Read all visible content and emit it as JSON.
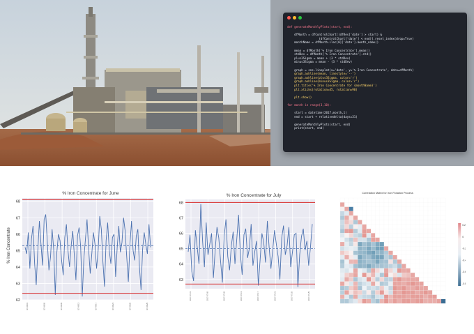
{
  "code": {
    "colors": {
      "bg": "#20232b",
      "keyword": "#ff7a90",
      "func": "#ffd66b",
      "string": "#8fe07a",
      "number": "#c98cff",
      "text": "#e2e6ee"
    },
    "dots": [
      "#ff5f57",
      "#febc2e",
      "#28c840"
    ],
    "lines": [
      "def generateMonthlyPlots(start, end):",
      "",
      "    dfMonth = dfControlChart[(dfRes['date'] > start) &",
      "                  (dfControlChart['date'] < end)].reset_index(drop=True)",
      "    monthName = dfMonth.iloc[0]['date'].month_name()",
      "",
      "    mean = dfMonth['% Iron Concentrate'].mean()",
      "    stdDev = dfMonth['% Iron Concentrate'].std()",
      "    plus3Sigma = mean + (3 * stdDev)",
      "    minus3Sigma = mean - (3 * stdDev)",
      "",
      "    graph = sns.lineplot(x='date', y='% Iron Concentrate', data=dfMonth)",
      "    graph.axhline(mean, linestyle='--')",
      "    graph.axhline(plus3Sigma, color='r')",
      "    graph.axhline(minus3Sigma, color='r')",
      "    plt.title('% Iron Concentrate for {monthName}')",
      "    plt.xticks(rotation=45, rotation=90)",
      "",
      "    plt.show()",
      "",
      "for month in range(3,10):",
      "",
      "    start = datetime(2017,month,1)",
      "    end = start + relativedelta(days=31)",
      "",
      "    generateMonthlyPlots(start, end)",
      "    print(start, end)"
    ]
  },
  "charts": [
    {
      "title": "% Iron Concentrate for June",
      "ylabel": "% Iron Concentrate",
      "yticks": [
        "68",
        "67",
        "66",
        "65",
        "64",
        "63",
        "62"
      ],
      "xticks": [
        "2017-06-01",
        "2017-06-05",
        "2017-06-09",
        "2017-06-13",
        "2017-06-17",
        "2017-06-21",
        "2017-06-25",
        "2017-06-29"
      ]
    },
    {
      "title": "% Iron Concentrate for July",
      "yticks": [
        "68",
        "67",
        "66",
        "65",
        "64",
        "63"
      ],
      "xticks": [
        "2017-07-01",
        "2017-07-05",
        "2017-07-09",
        "2017-07-13",
        "2017-07-17",
        "2017-07-21",
        "2017-07-25",
        "2017-07-29"
      ]
    }
  ],
  "chart_data": [
    {
      "type": "line",
      "title": "% Iron Concentrate for June",
      "ylabel": "% Iron Concentrate",
      "xlabel": "",
      "ylim": [
        62,
        68.2
      ],
      "mean": 65.3,
      "plus3Sigma": 68.1,
      "minus3Sigma": 62.4,
      "series": [
        {
          "values": [
            65.2,
            64.8,
            66.1,
            63.9,
            65.7,
            66.5,
            64.2,
            62.9,
            65.0,
            66.8,
            65.4,
            64.1,
            66.9,
            67.2,
            65.5,
            63.8,
            64.6,
            66.3,
            65.1,
            62.3,
            64.9,
            66.0,
            65.6,
            64.4,
            63.5,
            65.8,
            66.6,
            65.0,
            64.0,
            65.3,
            66.2,
            64.7,
            63.2,
            65.9,
            66.4,
            65.2,
            62.2,
            64.5,
            65.7,
            66.9,
            65.1,
            63.6,
            64.8,
            66.1,
            65.4,
            63.9,
            65.0,
            67.1,
            66.3,
            64.3,
            62.8,
            65.6,
            66.7,
            65.0,
            64.2,
            65.8,
            66.0,
            63.4,
            65.2,
            66.5,
            64.9,
            65.5,
            67.0,
            66.2,
            64.6,
            63.1,
            65.3,
            66.8,
            65.0,
            64.4,
            65.9,
            66.3,
            64.0,
            62.6,
            65.1,
            66.1,
            65.4,
            64.8,
            66.6,
            65.2
          ]
        }
      ]
    },
    {
      "type": "line",
      "title": "% Iron Concentrate for July",
      "ylabel": "",
      "xlabel": "",
      "ylim": [
        62.4,
        68.2
      ],
      "mean": 65.0,
      "plus3Sigma": 68.0,
      "minus3Sigma": 62.7,
      "series": [
        {
          "values": [
            64.8,
            65.9,
            63.5,
            62.9,
            66.2,
            65.1,
            64.0,
            67.9,
            65.5,
            63.8,
            66.7,
            64.6,
            65.3,
            66.0,
            63.1,
            64.9,
            66.4,
            65.7,
            64.2,
            62.8,
            65.8,
            66.9,
            64.5,
            63.6,
            65.2,
            66.1,
            64.0,
            65.6,
            67.2,
            64.7,
            63.3,
            65.9,
            66.3,
            64.4,
            65.0,
            66.6,
            63.9,
            64.8,
            65.5,
            62.6,
            64.3,
            66.0,
            65.4,
            64.1,
            66.8,
            65.1,
            63.7,
            64.9,
            66.2,
            65.3,
            64.5,
            63.0,
            65.7,
            66.5,
            64.6,
            65.2,
            66.4,
            63.8,
            64.8,
            65.9,
            66.0,
            62.5,
            64.6,
            65.8,
            66.3,
            64.9,
            65.5,
            63.9,
            65.1,
            66.6
          ]
        }
      ]
    },
    {
      "type": "heatmap",
      "title": "Correlation Matrix for Iron Flotation Process",
      "size": 24,
      "colorbar_ticks": [
        "0.2",
        "0",
        "-0.2",
        "-0.4",
        "-0.6",
        "-0.8"
      ]
    }
  ]
}
